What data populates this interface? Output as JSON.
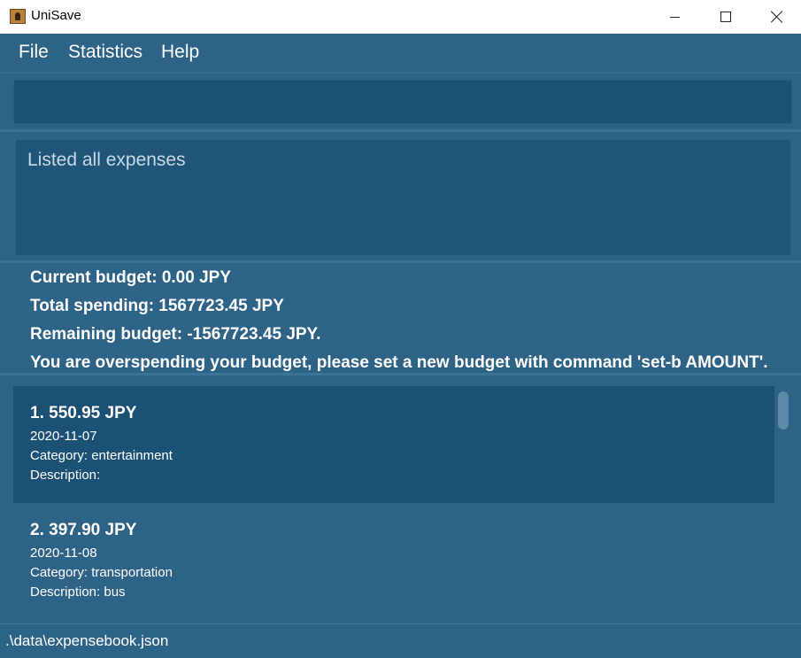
{
  "window": {
    "title": "UniSave",
    "controls": {
      "minimize_icon": "minimize-icon",
      "maximize_icon": "maximize-icon",
      "close_icon": "close-icon"
    }
  },
  "menu": {
    "items": [
      {
        "label": "File"
      },
      {
        "label": "Statistics"
      },
      {
        "label": "Help"
      }
    ]
  },
  "command": {
    "value": "",
    "placeholder": ""
  },
  "result": {
    "text": "Listed all expenses"
  },
  "budget": {
    "current": "Current budget: 0.00 JPY",
    "total_spending": "Total spending: 1567723.45 JPY",
    "remaining": "Remaining budget: -1567723.45 JPY.",
    "warning": "You are overspending your budget, please set a new budget with command 'set-b AMOUNT'."
  },
  "expenses": [
    {
      "header": "1.  550.95 JPY",
      "date": "2020-11-07",
      "category": "Category: entertainment",
      "description": "Description: "
    },
    {
      "header": "2.  397.90 JPY",
      "date": "2020-11-08",
      "category": "Category: transportation",
      "description": "Description: bus"
    }
  ],
  "status": {
    "path": ".\\data\\expensebook.json"
  },
  "colors": {
    "background": "#2d6386",
    "panel_dark": "#1b5174",
    "text": "#ffffff",
    "result_text": "#c8dae6"
  }
}
